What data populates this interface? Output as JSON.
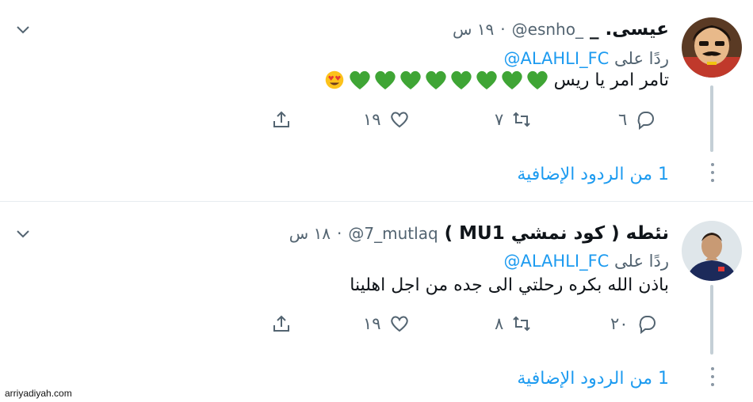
{
  "tweets": [
    {
      "name": "عيسى. _",
      "handle": "@esnho_",
      "separator": "·",
      "time": "١٩ س",
      "reply_prefix": "ردًا على",
      "reply_mention": "@ALAHLI_FC",
      "text": "تامر امر يا ريس",
      "emoji": [
        "green-heart",
        "green-heart",
        "green-heart",
        "green-heart",
        "green-heart",
        "green-heart",
        "green-heart",
        "green-heart",
        "heart-eyes"
      ],
      "counts": {
        "replies": "٦",
        "retweets": "٧",
        "likes": "١٩"
      },
      "more_replies": "1 من الردود الإضافية"
    },
    {
      "name": "نئطه ( كود نمشي MU1 )",
      "handle": "@7_mutlaq",
      "separator": "·",
      "time": "١٨ س",
      "reply_prefix": "ردًا على",
      "reply_mention": "@ALAHLI_FC",
      "text": "باذن الله بكره رحلتي الى جده من اجل اهلينا",
      "counts": {
        "replies": "٢٠",
        "retweets": "٨",
        "likes": "١٩"
      },
      "more_replies": "1 من الردود الإضافية"
    }
  ],
  "colors": {
    "link": "#1d9bf0",
    "secondary": "#536471",
    "heart_green": "#3fa535"
  },
  "watermark": "arriyadiyah.com"
}
